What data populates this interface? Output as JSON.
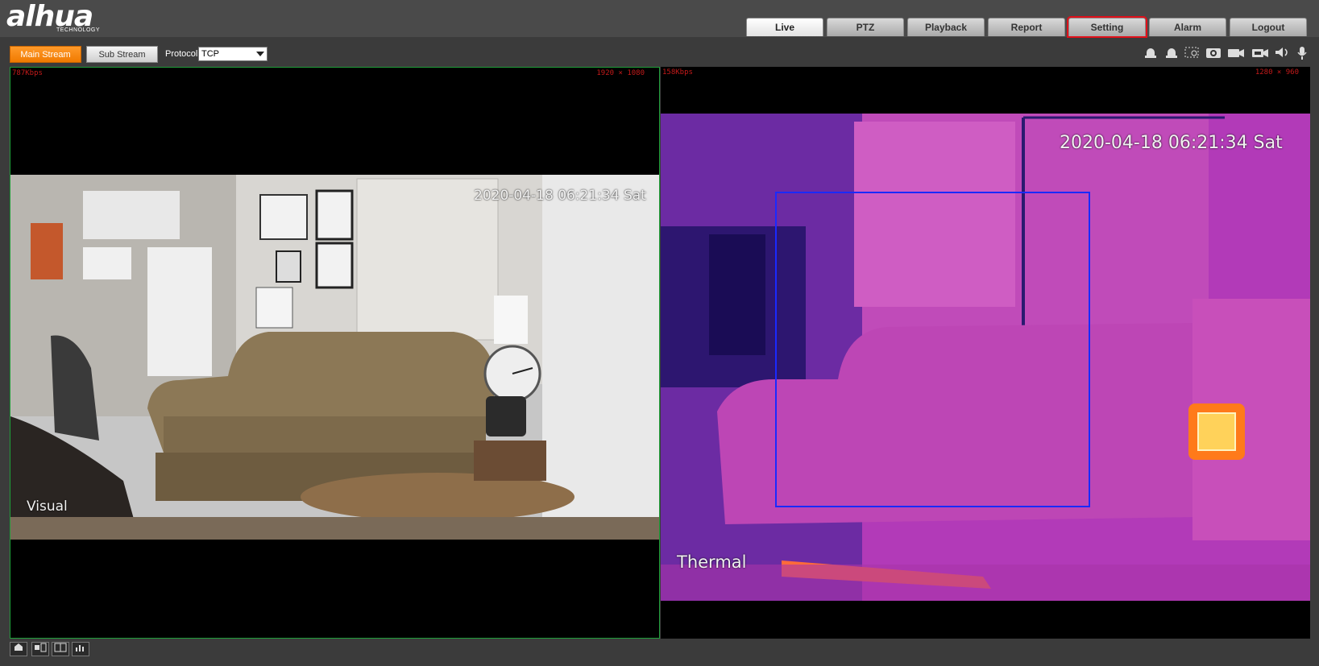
{
  "brand": {
    "logo": "alhua",
    "sub": "TECHNOLOGY"
  },
  "nav": {
    "tabs": [
      {
        "label": "Live"
      },
      {
        "label": "PTZ"
      },
      {
        "label": "Playback"
      },
      {
        "label": "Report"
      },
      {
        "label": "Setting"
      },
      {
        "label": "Alarm"
      },
      {
        "label": "Logout"
      }
    ]
  },
  "toolbar": {
    "main_stream": "Main Stream",
    "sub_stream": "Sub Stream",
    "protocol_label": "Protocol",
    "protocol_value": "TCP",
    "icons": [
      "alarm-out-icon",
      "alarm-out-2-icon",
      "zoom-region-icon",
      "snapshot-icon",
      "record-icon",
      "record-2-icon",
      "audio-icon",
      "mic-icon"
    ]
  },
  "visual": {
    "bitrate": "787Kbps",
    "resolution": "1920 × 1080",
    "timestamp": "2020-04-18 06:21:34 Sat",
    "label": "Visual"
  },
  "thermal": {
    "bitrate": "158Kbps",
    "resolution": "1280 × 960",
    "timestamp": "2020-04-18 06:21:34 Sat",
    "label": "Thermal"
  },
  "bottom": {
    "icons": [
      "fullscreen-icon",
      "ratio-icon",
      "layout-icon",
      "stats-icon"
    ]
  }
}
